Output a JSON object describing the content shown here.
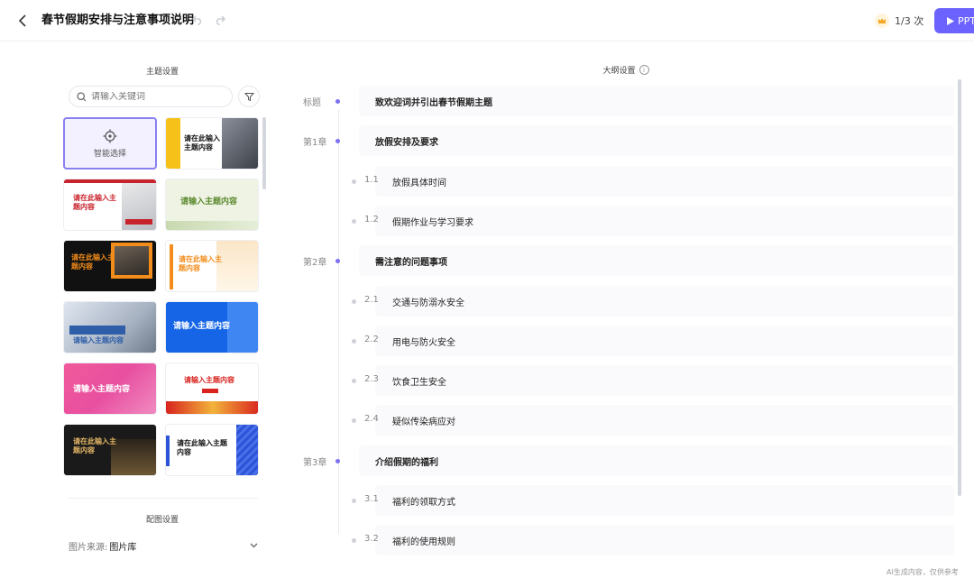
{
  "header": {
    "title": "春节假期安排与注意事项说明",
    "quota": "1/3 次",
    "ppt_label": "PPT"
  },
  "theme_panel": {
    "title": "主题设置",
    "search_placeholder": "请输入关键词",
    "smart_label": "智能选择",
    "cards": [
      {
        "id": "t1",
        "text": "请在此输入主题内容",
        "bg": "#ffffff",
        "accent": "#f6c21a"
      },
      {
        "id": "t2",
        "text": "请在此输入主题内容",
        "bg": "#ffffff",
        "accent": "#c8232c"
      },
      {
        "id": "t3",
        "text": "请输入主题内容",
        "bg": "#eef3e4",
        "accent": "#5c8a2e"
      },
      {
        "id": "t4",
        "text": "请在此输入主题内容",
        "bg": "#111111",
        "accent": "#f28c1a"
      },
      {
        "id": "t5",
        "text": "请在此输入主题内容",
        "bg": "#ffffff",
        "accent": "#f28c1a"
      },
      {
        "id": "t6",
        "text": "请输入主题内容",
        "bg": "#e8eef7",
        "accent": "#2f5ea8"
      },
      {
        "id": "t7",
        "text": "请输入主题内容",
        "bg": "#1565e6",
        "accent": "#ffffff"
      },
      {
        "id": "t8",
        "text": "请输入主题内容",
        "bg": "#e84fa0",
        "accent": "#ffffff"
      },
      {
        "id": "t9",
        "text": "请输入主题内容",
        "bg": "#ffffff",
        "accent": "#d8231e"
      },
      {
        "id": "t10",
        "text": "请在此输入主题内容",
        "bg": "#1a1a1a",
        "accent": "#e5b866"
      },
      {
        "id": "t11",
        "text": "请在此输入主题内容",
        "bg": "#ffffff",
        "accent": "#2c54d8"
      }
    ]
  },
  "image_settings": {
    "title": "配图设置",
    "source_label": "图片来源:",
    "source_value": "图片库"
  },
  "outline": {
    "heading": "大纲设置",
    "rows": [
      {
        "kind": "title",
        "label": "标题",
        "text": "致欢迎词并引出春节假期主题"
      },
      {
        "kind": "chapter",
        "label": "第1章",
        "text": "放假安排及要求"
      },
      {
        "kind": "section",
        "label": "1.1",
        "text": "放假具体时间"
      },
      {
        "kind": "section",
        "label": "1.2",
        "text": "假期作业与学习要求"
      },
      {
        "kind": "chapter",
        "label": "第2章",
        "text": "需注意的问题事项"
      },
      {
        "kind": "section",
        "label": "2.1",
        "text": "交通与防溺水安全"
      },
      {
        "kind": "section",
        "label": "2.2",
        "text": "用电与防火安全"
      },
      {
        "kind": "section",
        "label": "2.3",
        "text": "饮食卫生安全"
      },
      {
        "kind": "section",
        "label": "2.4",
        "text": "疑似传染病应对"
      },
      {
        "kind": "chapter",
        "label": "第3章",
        "text": "介绍假期的福利"
      },
      {
        "kind": "section",
        "label": "3.1",
        "text": "福利的领取方式"
      },
      {
        "kind": "section",
        "label": "3.2",
        "text": "福利的使用规则"
      }
    ]
  },
  "footer": {
    "note": "AI生成内容，仅供参考"
  },
  "colors": {
    "accent": "#6c63ff",
    "dot_primary": "#7b6ff2",
    "dot_secondary": "#cfd1d8"
  }
}
